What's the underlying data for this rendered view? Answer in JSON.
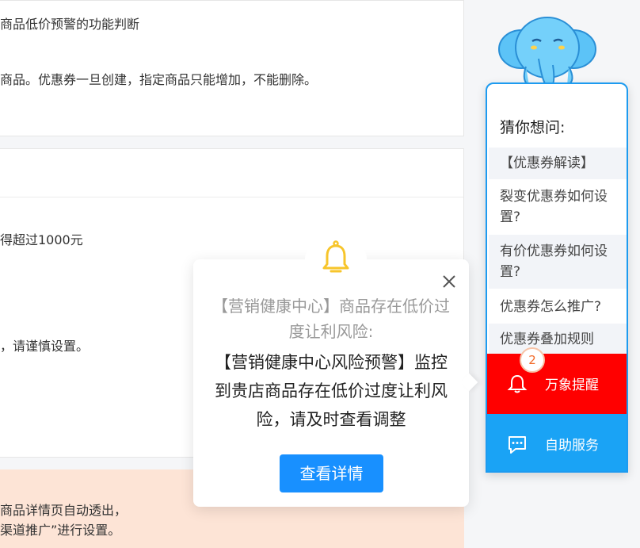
{
  "background": {
    "card1": {
      "line1": "商品低价预警的功能判断",
      "line2": "商品。优惠券一旦创建，指定商品只能增加，不能删除。"
    },
    "card2": {
      "line1": "得超过1000元",
      "line2": "，请谨慎设置。"
    },
    "notice": {
      "line1": "商品详情页自动透出，",
      "line2": "渠道推广”进行设置。"
    }
  },
  "sidebar": {
    "guess_title": "猜你想问:",
    "questions": [
      "【优惠券解读】",
      "裂变优惠券如何设置?",
      "有价优惠券如何设置?",
      "优惠券怎么推广?",
      "优惠券叠加规则"
    ],
    "remind_label": "万象提醒",
    "remind_badge": "2",
    "service_label": "自助服务",
    "colors": {
      "remind": "#ff0000",
      "service": "#1aa3f5",
      "border": "#1d9bf0"
    }
  },
  "popup": {
    "title": "【营销健康中心】商品存在低价过度让利风险:",
    "body": "【营销健康中心风险预警】监控到贵店商品存在低价过度让利风险，请及时查看调整",
    "detail_button": "查看详情",
    "icons": {
      "bell": "bell-icon",
      "close": "close-icon"
    },
    "colors": {
      "button": "#1890ff",
      "bell": "#f7c52b"
    }
  }
}
